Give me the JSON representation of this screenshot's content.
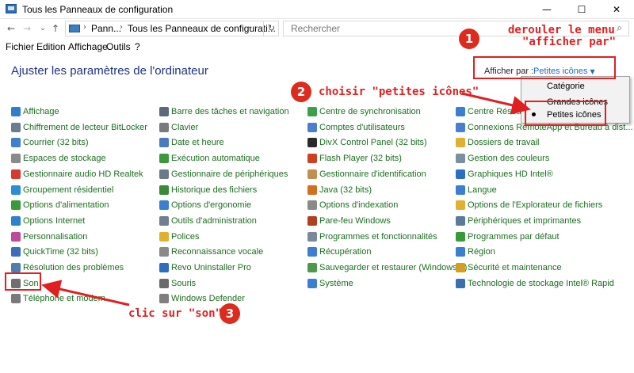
{
  "window": {
    "title": "Tous les Panneaux de configuration",
    "minimize": "—",
    "maximize": "☐",
    "close": "✕"
  },
  "nav": {
    "back": "←",
    "forward": "→",
    "recent": "⌄",
    "up": "↑"
  },
  "address": {
    "crumbs": [
      "Pann...",
      "Tous les Panneaux de configurati..."
    ],
    "separator": "›",
    "dropdown": "⌄",
    "refresh": "↻"
  },
  "search": {
    "placeholder": "Rechercher",
    "icon": "search-icon"
  },
  "menu": [
    "Fichier",
    "Edition",
    "Affichage",
    "Outils",
    "?"
  ],
  "page": {
    "title": "Ajuster les paramètres de l'ordinateur",
    "view_by_label": "Afficher par :",
    "view_by_value": "Petites icônes"
  },
  "dropdown": {
    "options": [
      "Catégorie",
      "Grandes icônes",
      "Petites icônes"
    ],
    "selected": "Petites icônes"
  },
  "columns": [
    [
      "Affichage",
      "Chiffrement de lecteur BitLocker",
      "Courrier (32 bits)",
      "Espaces de stockage",
      "Gestionnaire audio HD Realtek",
      "Groupement résidentiel",
      "Options d'alimentation",
      "Options Internet",
      "Personnalisation",
      "QuickTime (32 bits)",
      "Résolution des problèmes",
      "Son",
      "Téléphone et modem"
    ],
    [
      "Barre des tâches et navigation",
      "Clavier",
      "Date et heure",
      "Exécution automatique",
      "Gestionnaire de périphériques",
      "Historique des fichiers",
      "Options d'ergonomie",
      "Outils d'administration",
      "Polices",
      "Reconnaissance vocale",
      "Revo Uninstaller Pro",
      "Souris",
      "Windows Defender"
    ],
    [
      "Centre de synchronisation",
      "Comptes d'utilisateurs",
      "DivX Control Panel (32 bits)",
      "Flash Player (32 bits)",
      "Gestionnaire d'identification",
      "Java (32 bits)",
      "Options d'indexation",
      "Pare-feu Windows",
      "Programmes et fonctionnalités",
      "Récupération",
      "Sauvegarder et restaurer (Windows 7)",
      "Système"
    ],
    [
      "Centre Réseau et partage",
      "Connexions RemoteApp et Bureau à dist...",
      "Dossiers de travail",
      "Gestion des couleurs",
      "Graphiques HD Intel®",
      "Langue",
      "Options de l'Explorateur de fichiers",
      "Périphériques et imprimantes",
      "Programmes par défaut",
      "Région",
      "Sécurité et maintenance",
      "Technologie de stockage Intel® Rapid"
    ]
  ],
  "icon_colors": [
    [
      "#2f7fd0",
      "#6b7d90",
      "#3d7fd0",
      "#8a8a8a",
      "#d63a2e",
      "#2a8fd8",
      "#3a9a3a",
      "#2f80d0",
      "#c04a9a",
      "#3a6fc0",
      "#4a7fb0",
      "#6f6f6f",
      "#7a7a7a"
    ],
    [
      "#5a6a7a",
      "#7a7a7a",
      "#4a7ac0",
      "#3a9a3a",
      "#6a7a8a",
      "#3a8a3a",
      "#3a7fd0",
      "#6f7f8f",
      "#e0b030",
      "#8a8a8a",
      "#2a6fc0",
      "#6a6a6a",
      "#7f7f7f"
    ],
    [
      "#3aa04a",
      "#4a7fd0",
      "#2a2a2a",
      "#d04020",
      "#c09050",
      "#d07020",
      "#8a8a8a",
      "#b04020",
      "#7a8a9a",
      "#3a7fd0",
      "#4a9a4a",
      "#3a7fd0"
    ],
    [
      "#3a7fd0",
      "#4a7fd0",
      "#e0b030",
      "#7a8fa0",
      "#2a6fc0",
      "#3a7fd0",
      "#e0b030",
      "#5a7a9a",
      "#3a9a3a",
      "#3a7fd0",
      "#d0a020",
      "#3a6fb0"
    ]
  ],
  "annotations": {
    "step1_number": "1",
    "step1_text_line1": "derouler le menu",
    "step1_text_line2": "\"afficher par\"",
    "step2_number": "2",
    "step2_text": "choisir \"petites icônes\"",
    "step3_number": "3",
    "step3_text": "clic sur \"son\"",
    "color": "#e02020"
  }
}
